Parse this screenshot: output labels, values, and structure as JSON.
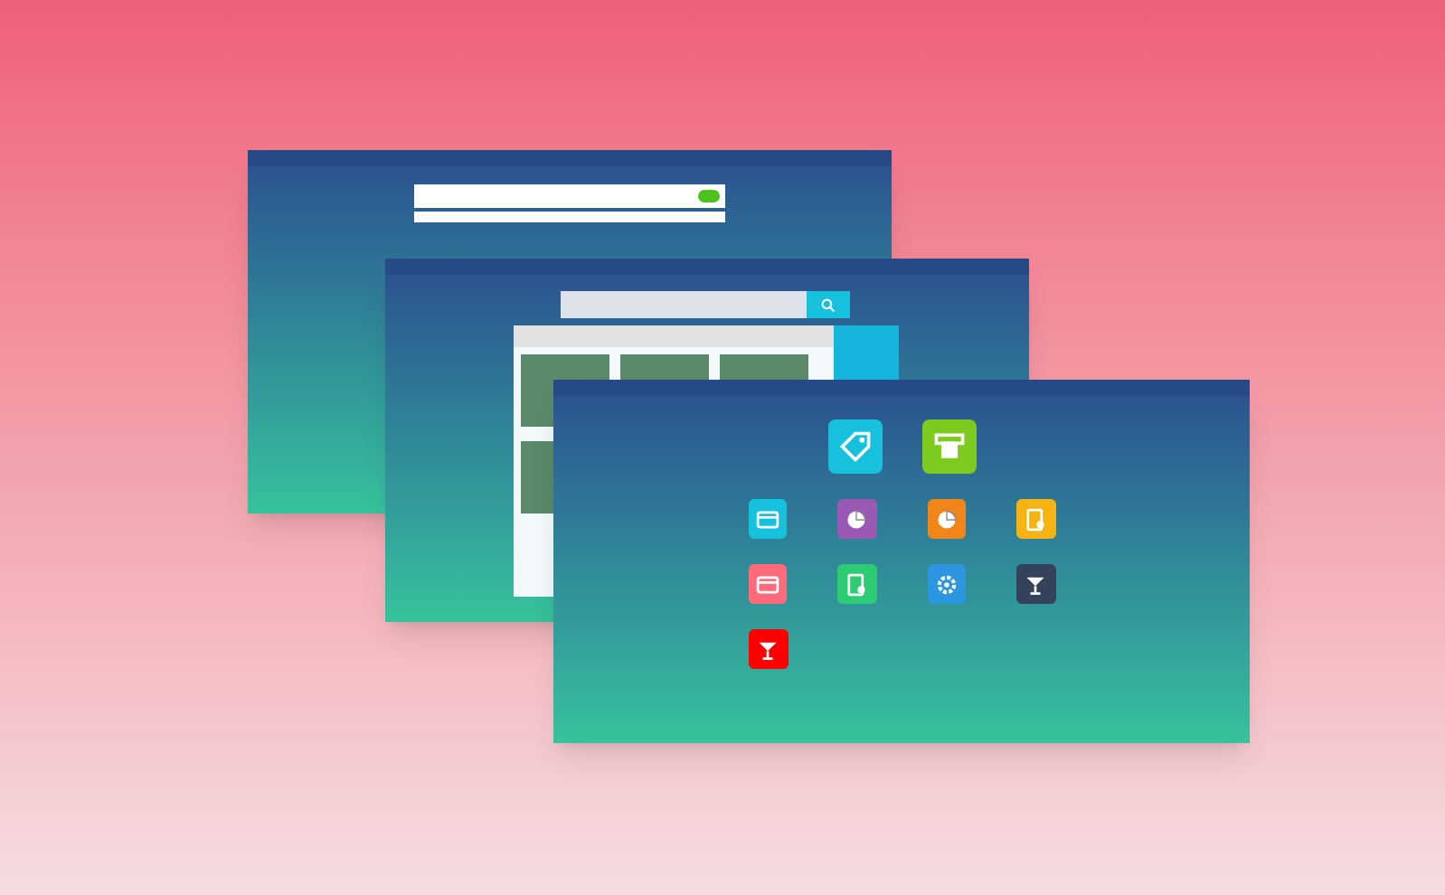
{
  "windows": [
    {
      "kind": "form"
    },
    {
      "kind": "search"
    },
    {
      "kind": "launcher",
      "tiles": [
        {
          "kind": "tag",
          "color": "#17c1dd"
        },
        {
          "kind": "printer",
          "color": "#7ecb20"
        },
        {
          "kind": "card",
          "color": "#16c1dd"
        },
        {
          "kind": "pie",
          "color": "#9b59b6"
        },
        {
          "kind": "pie",
          "color": "#f08519"
        },
        {
          "kind": "document",
          "color": "#f5b314"
        },
        {
          "kind": "card",
          "color": "#ff6b7a"
        },
        {
          "kind": "document",
          "color": "#2dcb73"
        },
        {
          "kind": "gear",
          "color": "#2d96e0"
        },
        {
          "kind": "glass",
          "color": "#34425a"
        },
        {
          "kind": "glass",
          "color": "#ff0000"
        }
      ]
    }
  ]
}
